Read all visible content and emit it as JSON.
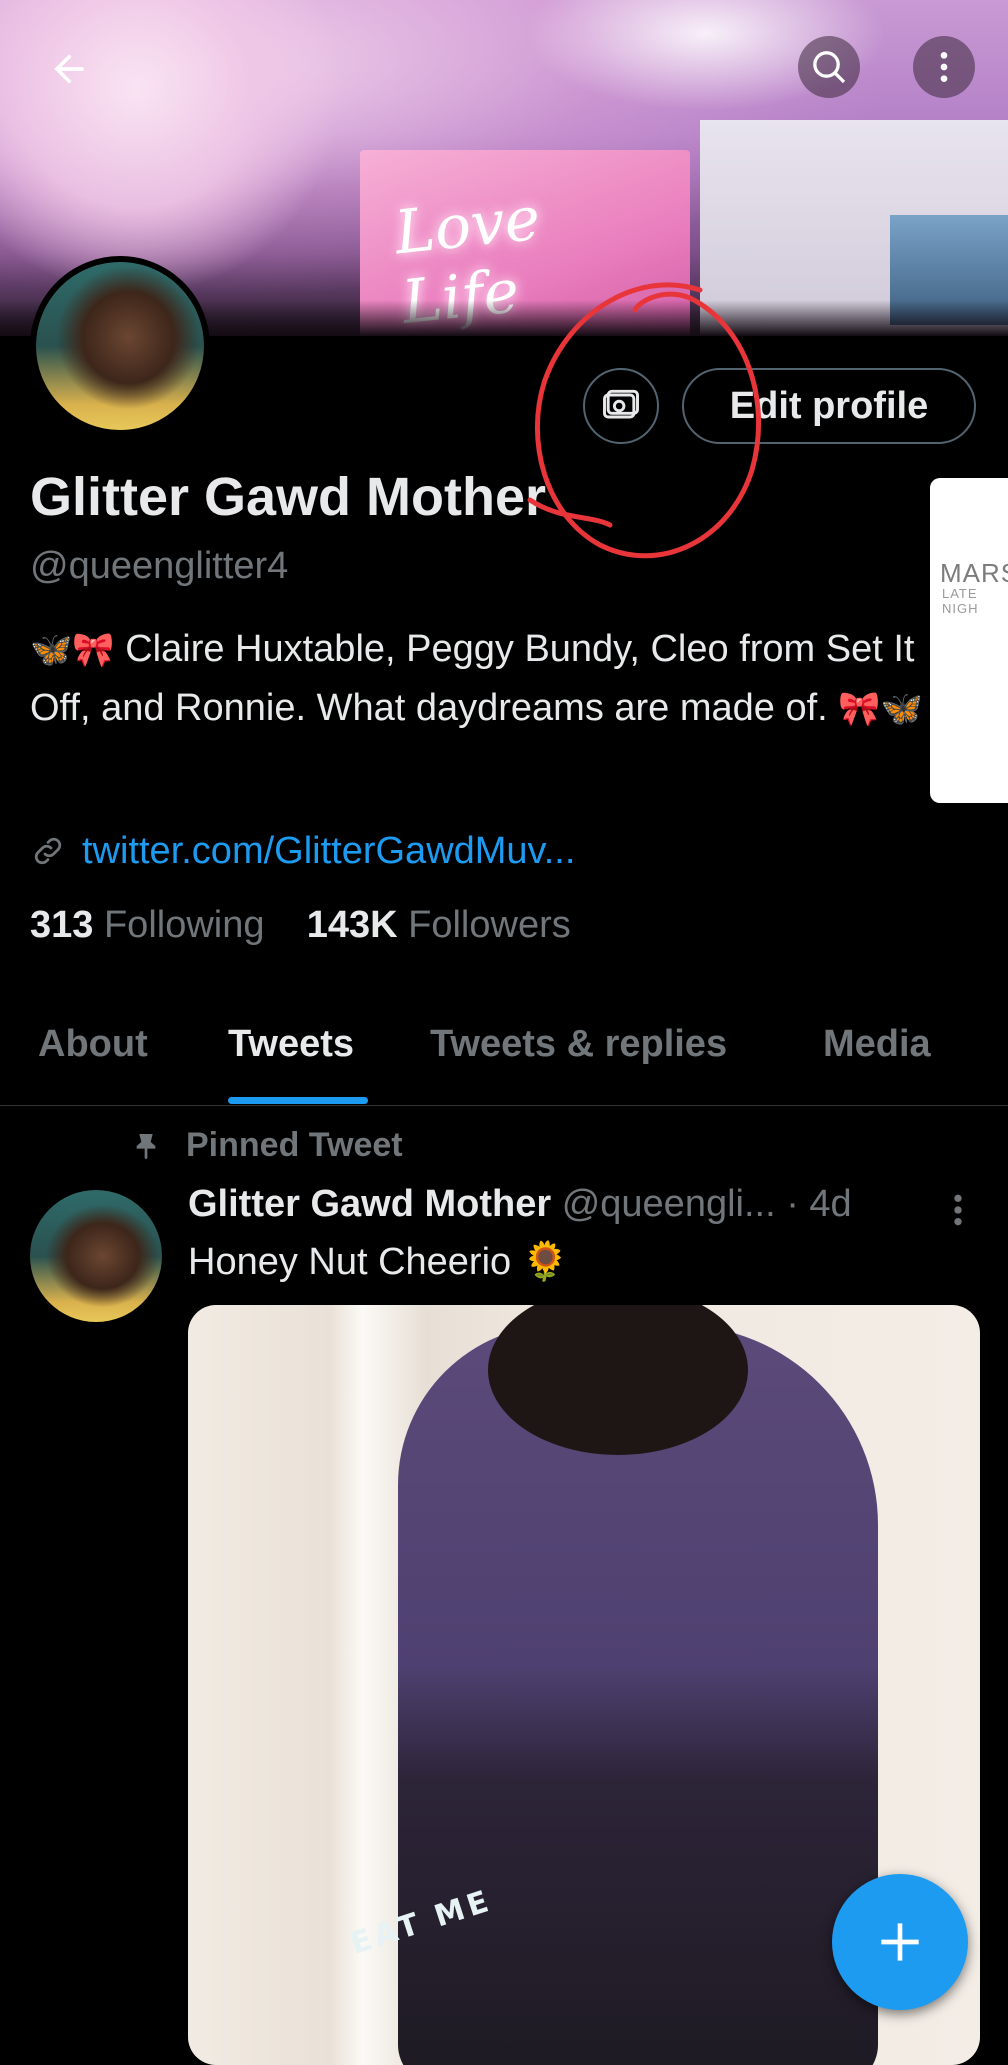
{
  "profile": {
    "display_name": "Glitter Gawd Mother",
    "handle": "@queenglitter4",
    "bio_prefix_emoji": "🦋🎀",
    "bio_text": "Claire Huxtable, Peggy Bundy, Cleo from Set It Off, and Ronnie. What daydreams are made of.",
    "bio_suffix_emoji": "🎀🦋",
    "link": "twitter.com/GlitterGawdMuv...",
    "following_count": "313",
    "following_label": "Following",
    "followers_count": "143K",
    "followers_label": "Followers"
  },
  "banner": {
    "neon_text": "Love Life"
  },
  "actions": {
    "edit_profile_label": "Edit profile"
  },
  "side_card": {
    "title": "MARSH",
    "subtitle": "LATE NIGH"
  },
  "tabs": [
    {
      "label": "About"
    },
    {
      "label": "Tweets"
    },
    {
      "label": "Tweets & replies"
    },
    {
      "label": "Media"
    }
  ],
  "active_tab": "Tweets",
  "pinned_tweet": {
    "pinned_label": "Pinned Tweet",
    "author_name": "Glitter Gawd Mother",
    "author_handle": "@queengli...",
    "time": "· 4d",
    "text": "Honey Nut Cheerio 🌻",
    "media_print_text": "EAT ME"
  },
  "colors": {
    "accent": "#1d9bf0",
    "background": "#000000",
    "secondary_text": "#71767b",
    "annotation": "#e8353a"
  },
  "icons": {
    "back": "arrow-left-icon",
    "search": "search-icon",
    "more": "more-vertical-icon",
    "tips": "tips-money-icon",
    "link": "link-icon",
    "pin": "pin-icon",
    "compose": "plus-icon"
  }
}
